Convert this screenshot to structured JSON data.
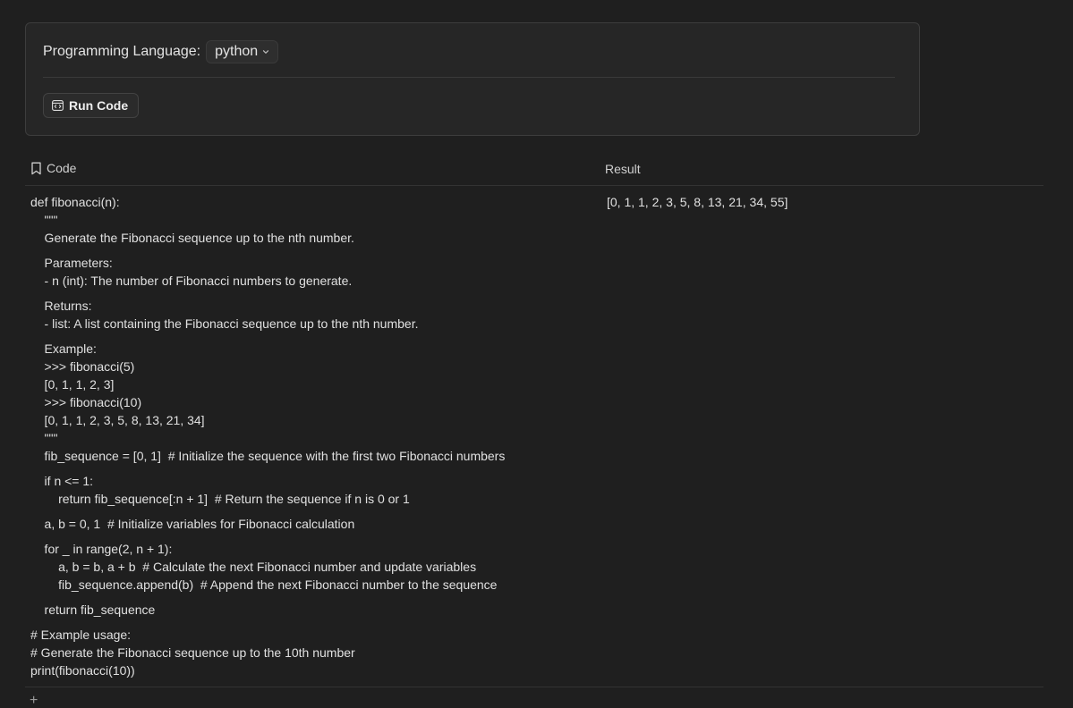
{
  "toolbar": {
    "language_label": "Programming Language:",
    "language_value": "python",
    "run_label": "Run Code"
  },
  "table": {
    "headers": {
      "code": "Code",
      "result": "Result"
    },
    "code_lines": [
      "def fibonacci(n):",
      "    \"\"\"",
      "    Generate the Fibonacci sequence up to the nth number.",
      "",
      "    Parameters:",
      "    - n (int): The number of Fibonacci numbers to generate.",
      "",
      "    Returns:",
      "    - list: A list containing the Fibonacci sequence up to the nth number.",
      "",
      "    Example:",
      "    >>> fibonacci(5)",
      "    [0, 1, 1, 2, 3]",
      "    >>> fibonacci(10)",
      "    [0, 1, 1, 2, 3, 5, 8, 13, 21, 34]",
      "    \"\"\"",
      "    fib_sequence = [0, 1]  # Initialize the sequence with the first two Fibonacci numbers",
      "",
      "    if n <= 1:",
      "        return fib_sequence[:n + 1]  # Return the sequence if n is 0 or 1",
      "",
      "    a, b = 0, 1  # Initialize variables for Fibonacci calculation",
      "",
      "    for _ in range(2, n + 1):",
      "        a, b = b, a + b  # Calculate the next Fibonacci number and update variables",
      "        fib_sequence.append(b)  # Append the next Fibonacci number to the sequence",
      "",
      "    return fib_sequence",
      "",
      "# Example usage:",
      "# Generate the Fibonacci sequence up to the 10th number",
      "print(fibonacci(10))"
    ],
    "result": "[0, 1, 1, 2, 3, 5, 8, 13, 21, 34, 55]",
    "add_row_label": "+"
  },
  "icons": {
    "run": "code-window-icon",
    "code_header": "bookmark-icon",
    "dropdown": "chevron-down-icon"
  }
}
